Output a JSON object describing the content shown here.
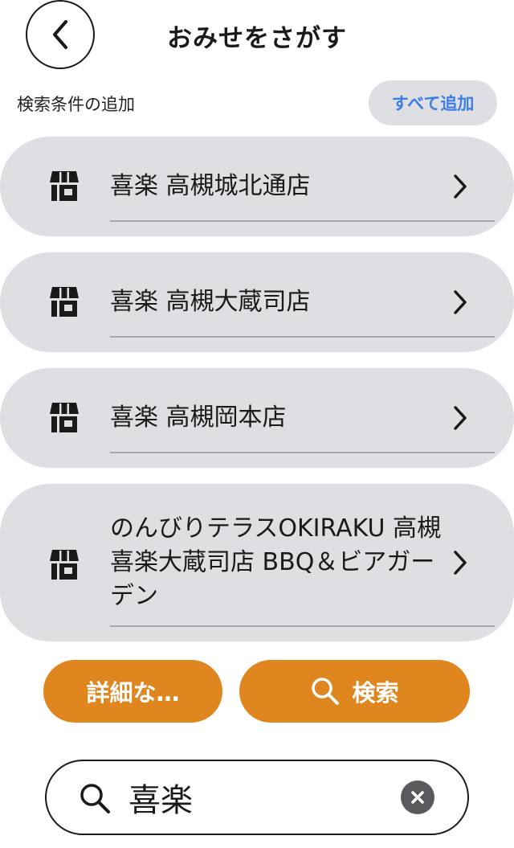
{
  "header": {
    "title": "おみせをさがす"
  },
  "conditions": {
    "label": "検索条件の追加",
    "add_all_label": "すべて追加"
  },
  "results": [
    {
      "name": "喜楽 高槻城北通店"
    },
    {
      "name": "喜楽 高槻大蔵司店"
    },
    {
      "name": "喜楽 高槻岡本店"
    },
    {
      "name": "のんびりテラスOKIRAKU 高槻喜楽大蔵司店 BBQ＆ビアガーデン"
    }
  ],
  "actions": {
    "details_label": "詳細な…",
    "search_label": "検索"
  },
  "search": {
    "value": "喜楽"
  },
  "colors": {
    "accent_orange": "#e0861f",
    "link_blue": "#3d7fe6",
    "item_background": "#dedee3"
  },
  "icons": {
    "back": "chevron-left-icon",
    "store": "store-icon",
    "chevron": "chevron-right-icon",
    "search": "search-icon",
    "clear": "clear-icon"
  }
}
